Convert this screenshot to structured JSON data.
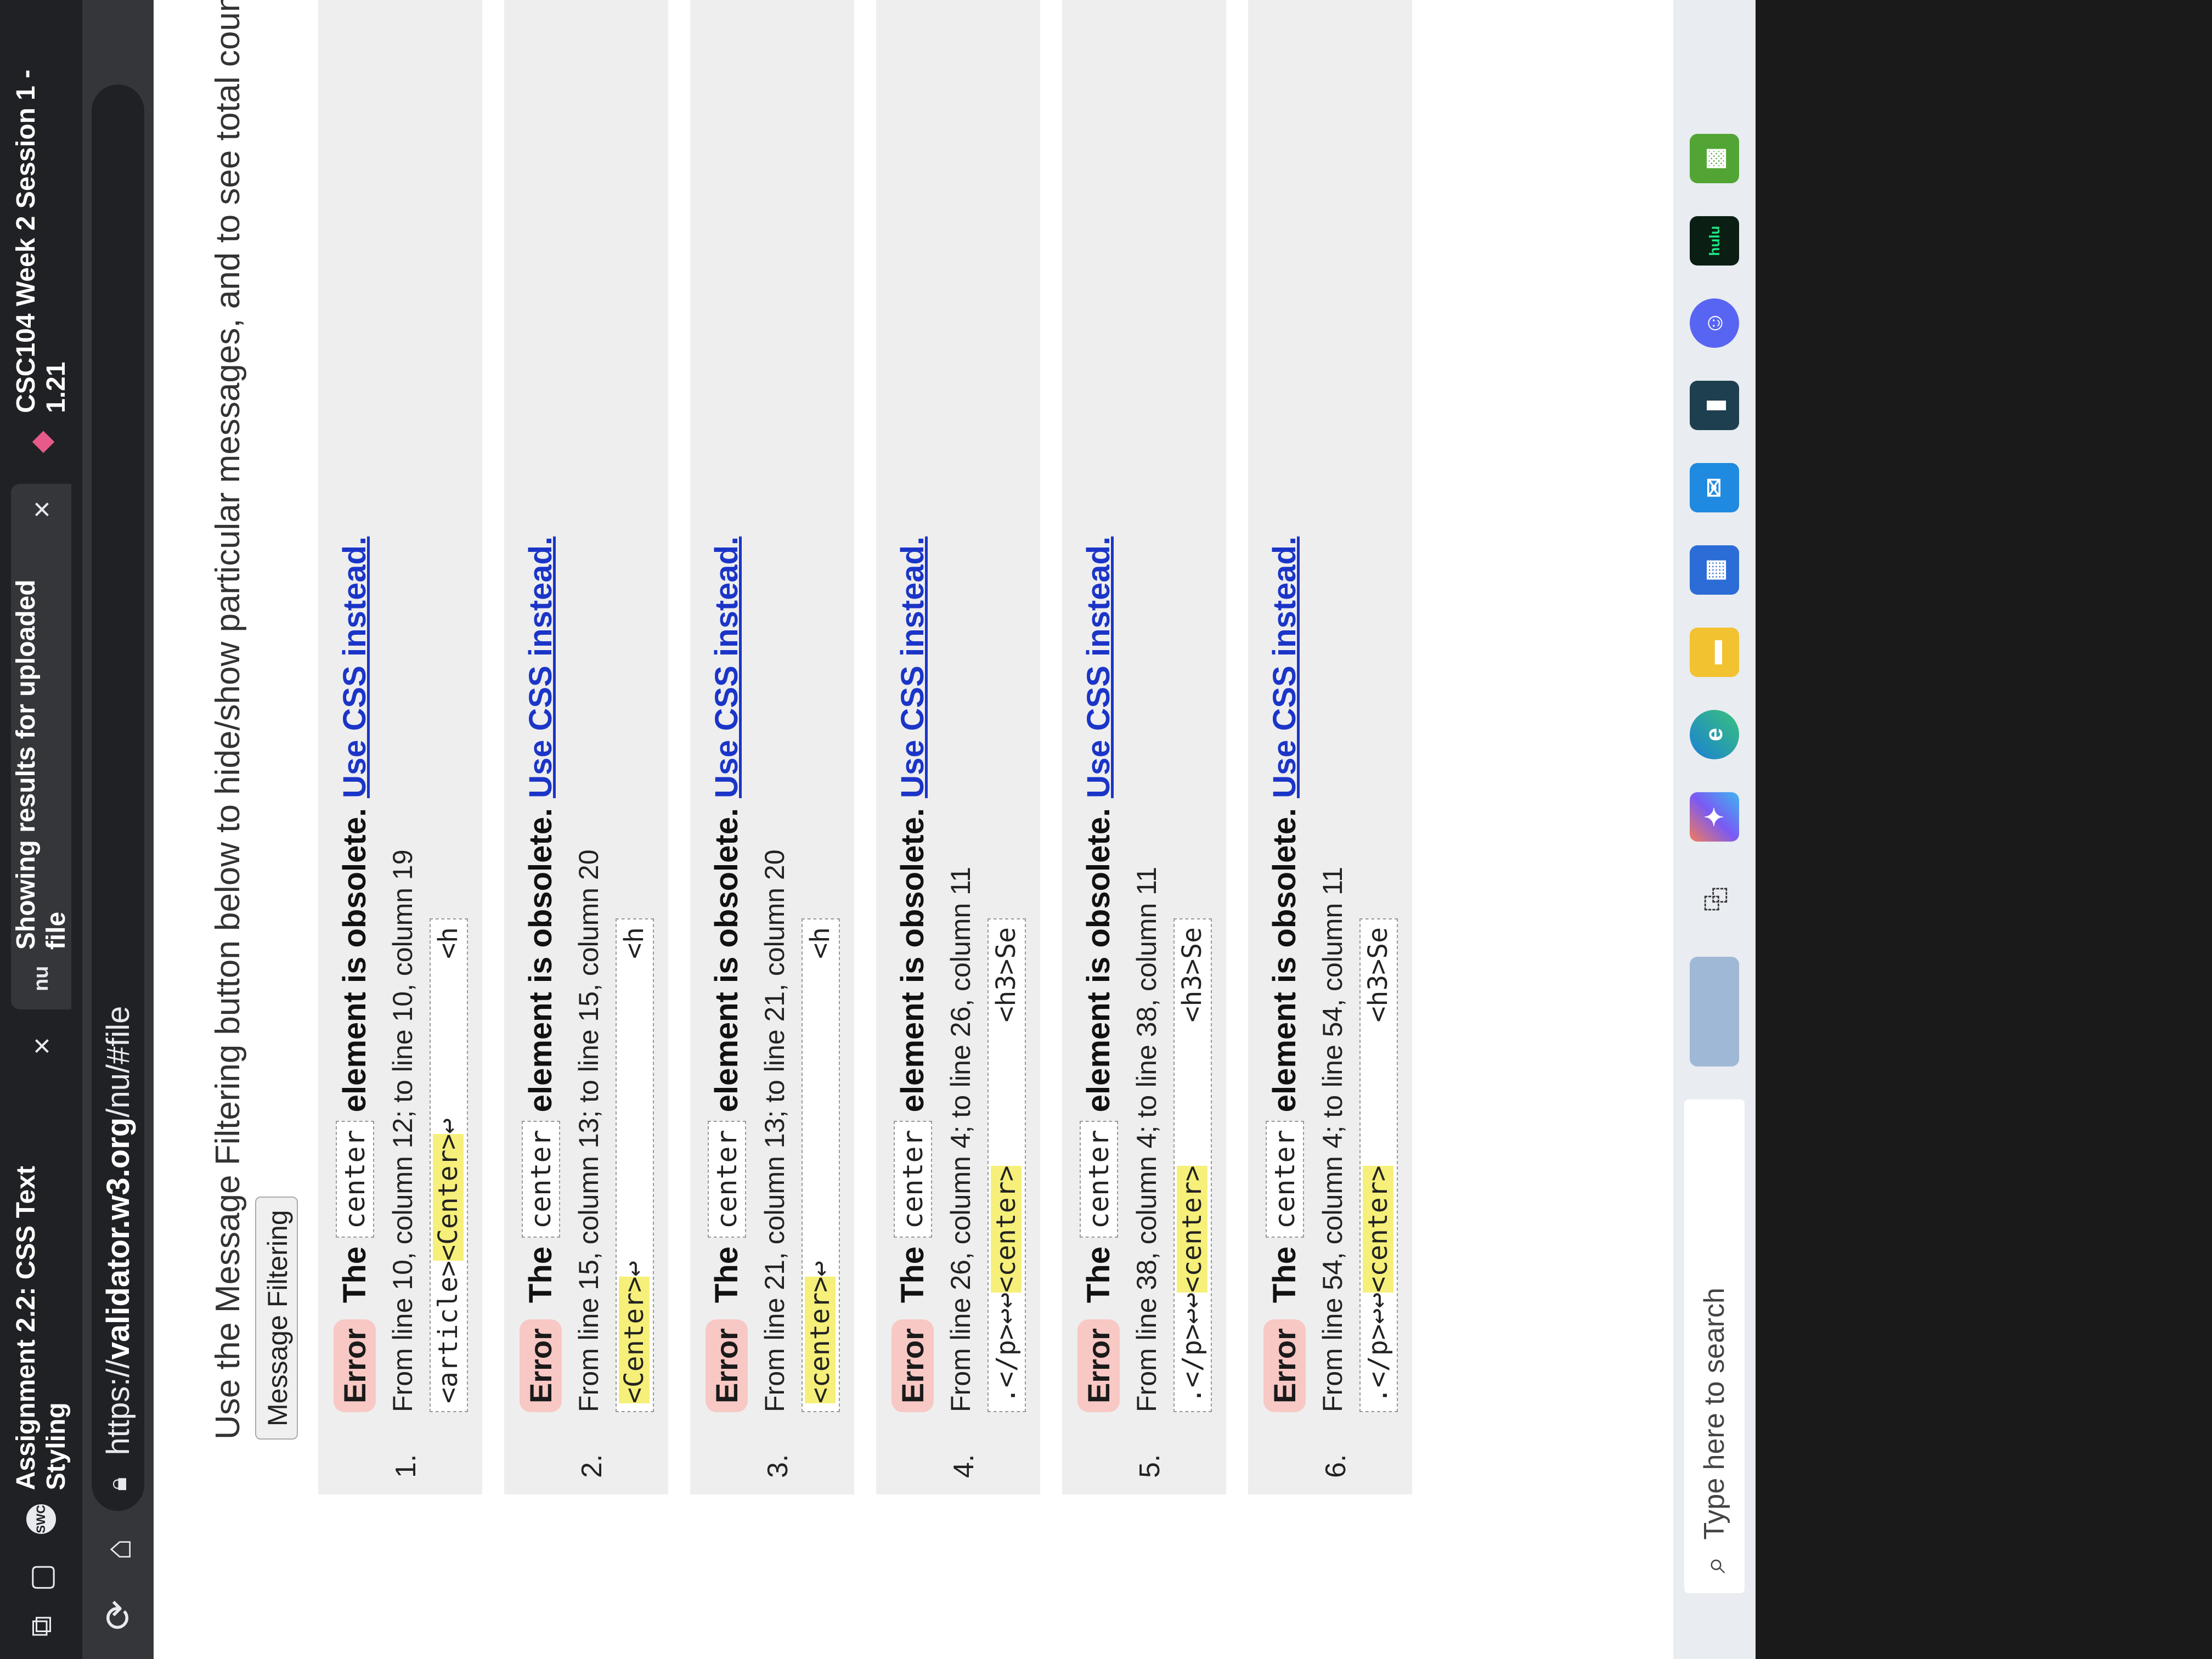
{
  "browser": {
    "tabs": [
      {
        "favicon": "SWC",
        "title": "Assignment 2.2: CSS Text Styling",
        "close": "×",
        "active": false
      },
      {
        "favicon": "nu",
        "title": "Showing results for uploaded file",
        "close": "×",
        "active": true
      },
      {
        "favicon": "pink-diamond-icon",
        "title": "CSC104 Week 2 Session 1 - 1.21",
        "active": false
      }
    ],
    "url_scheme": "https://",
    "url_host": "validator.w3.org",
    "url_path": "/nu/#file"
  },
  "page": {
    "intro": "Use the Message Filtering button below to hide/show particular messages, and to see total counts of errors",
    "filter_button": "Message Filtering",
    "messages": [
      {
        "num": "1.",
        "type": "Error",
        "pre": "The",
        "code": "center",
        "post": "element is obsolete.",
        "link": "Use CSS instead.",
        "location": "From line 10, column 12; to line 10, column 19",
        "extract_pre": "<article>",
        "extract_hl": "<Center>",
        "extract_nl": "↩",
        "extract_post": "<h"
      },
      {
        "num": "2.",
        "type": "Error",
        "pre": "The",
        "code": "center",
        "post": "element is obsolete.",
        "link": "Use CSS instead.",
        "location": "From line 15, column 13; to line 15, column 20",
        "extract_pre": "",
        "extract_hl": "<Center>",
        "extract_nl": "↩",
        "extract_post": "<h"
      },
      {
        "num": "3.",
        "type": "Error",
        "pre": "The",
        "code": "center",
        "post": "element is obsolete.",
        "link": "Use CSS instead.",
        "location": "From line 21, column 13; to line 21, column 20",
        "extract_pre": "",
        "extract_hl": "<center>",
        "extract_nl": "↩",
        "extract_post": "<h"
      },
      {
        "num": "4.",
        "type": "Error",
        "pre": "The",
        "code": "center",
        "post": "element is obsolete.",
        "link": "Use CSS instead.",
        "location": "From line 26, column 4; to line 26, column 11",
        "extract_pre": ".</p>↩↩",
        "extract_hl": "<center>",
        "extract_nl": "",
        "extract_post": "<h3>Se"
      },
      {
        "num": "5.",
        "type": "Error",
        "pre": "The",
        "code": "center",
        "post": "element is obsolete.",
        "link": "Use CSS instead.",
        "location": "From line 38, column 4; to line 38, column 11",
        "extract_pre": ".</p>↩↩",
        "extract_hl": "<center>",
        "extract_nl": "",
        "extract_post": "<h3>Se"
      },
      {
        "num": "6.",
        "type": "Error",
        "pre": "The",
        "code": "center",
        "post": "element is obsolete.",
        "link": "Use CSS instead.",
        "location": "From line 54, column 4; to line 54, column 11",
        "extract_pre": ".</p>↩↩",
        "extract_hl": "<center>",
        "extract_nl": "",
        "extract_post": "<h3>Se"
      }
    ]
  },
  "taskbar": {
    "search_placeholder": "Type here to search",
    "icons": [
      "task-view-icon",
      "copilot-icon",
      "edge-icon",
      "file-explorer-icon",
      "store-icon",
      "mail-icon",
      "terminal-icon",
      "discord-icon",
      "hulu-icon",
      "minecraft-icon"
    ],
    "hulu_label": "hulu"
  },
  "colors": {
    "error_badge": "#f8c8c4",
    "link": "#1b35c8",
    "highlight": "#f6f07a",
    "message_bg": "#eeeeee"
  }
}
